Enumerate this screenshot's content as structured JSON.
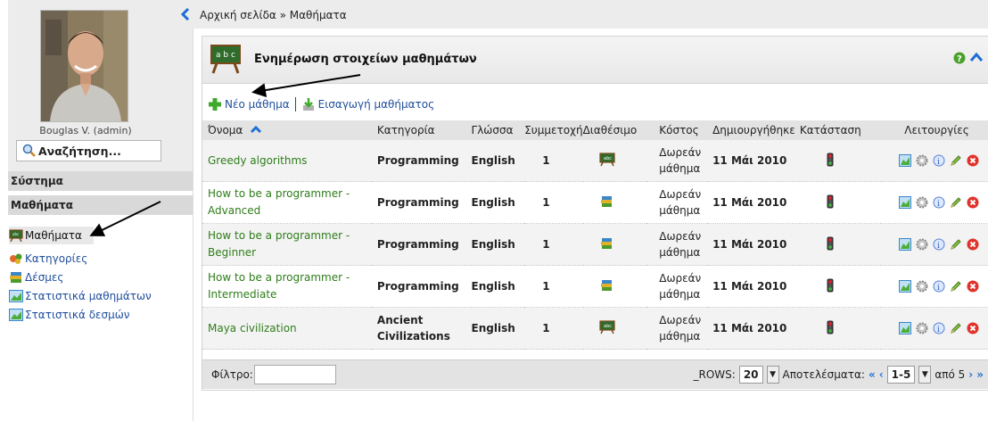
{
  "user": {
    "name": "Bouglas V. (admin)"
  },
  "search": {
    "label": "Αναζήτηση..."
  },
  "sidebar": {
    "sections": [
      "Σύστημα",
      "Μαθήματα"
    ],
    "items": [
      {
        "label": "Μαθήματα",
        "icon": "lesson-board-icon"
      },
      {
        "label": "Κατηγορίες",
        "icon": "categories-icon"
      },
      {
        "label": "Δέσμες",
        "icon": "books-icon"
      },
      {
        "label": "Στατιστικά μαθημάτων",
        "icon": "chart-icon"
      },
      {
        "label": "Στατιστικά δεσμών",
        "icon": "chart-icon"
      }
    ]
  },
  "breadcrumb": {
    "text": "Αρχική σελίδα » Μαθήματα"
  },
  "panel": {
    "title": "Ενημέρωση στοιχείων μαθημάτων"
  },
  "toolbar": {
    "new_course": "Νέο μάθημα",
    "import_course": "Εισαγωγή μαθήματος"
  },
  "table": {
    "headers": [
      "Όνομα",
      "Κατηγορία",
      "Γλώσσα",
      "Συμμετοχή",
      "Διαθέσιμο",
      "Κόστος",
      "Δημιουργήθηκε",
      "Κατάσταση",
      "Λειτουργίες"
    ],
    "rows": [
      {
        "name1": "Greedy algorithms",
        "name2": "",
        "category1": "Programming",
        "category2": "",
        "language": "English",
        "participation": "1",
        "cost1": "Δωρεάν",
        "cost2": "μάθημα",
        "created": "11 Μάι 2010",
        "icon": "lesson-board-icon"
      },
      {
        "name1": "How to be a programmer -",
        "name2": "Advanced",
        "category1": "Programming",
        "category2": "",
        "language": "English",
        "participation": "1",
        "cost1": "Δωρεάν",
        "cost2": "μάθημα",
        "created": "11 Μάι 2010",
        "icon": "books-icon"
      },
      {
        "name1": "How to be a programmer -",
        "name2": "Beginner",
        "category1": "Programming",
        "category2": "",
        "language": "English",
        "participation": "1",
        "cost1": "Δωρεάν",
        "cost2": "μάθημα",
        "created": "11 Μάι 2010",
        "icon": "books-icon"
      },
      {
        "name1": "How to be a programmer -",
        "name2": "Intermediate",
        "category1": "Programming",
        "category2": "",
        "language": "English",
        "participation": "1",
        "cost1": "Δωρεάν",
        "cost2": "μάθημα",
        "created": "11 Μάι 2010",
        "icon": "books-icon"
      },
      {
        "name1": "Maya civilization",
        "name2": "",
        "category1": "Ancient",
        "category2": "Civilizations",
        "language": "English",
        "participation": "1",
        "cost1": "Δωρεάν",
        "cost2": "μάθημα",
        "created": "11 Μάι 2010",
        "icon": "lesson-board-icon"
      }
    ]
  },
  "footer": {
    "filter_label": "Φίλτρο:",
    "rows_label": "_ROWS:",
    "rows_value": "20",
    "results_label": "Αποτελέσματα:",
    "range_value": "1-5",
    "of_text": "από 5"
  },
  "colors": {
    "accent": "#1f6fd6",
    "link_green": "#2e7d1a",
    "header_bg": "#e3e3e3"
  }
}
